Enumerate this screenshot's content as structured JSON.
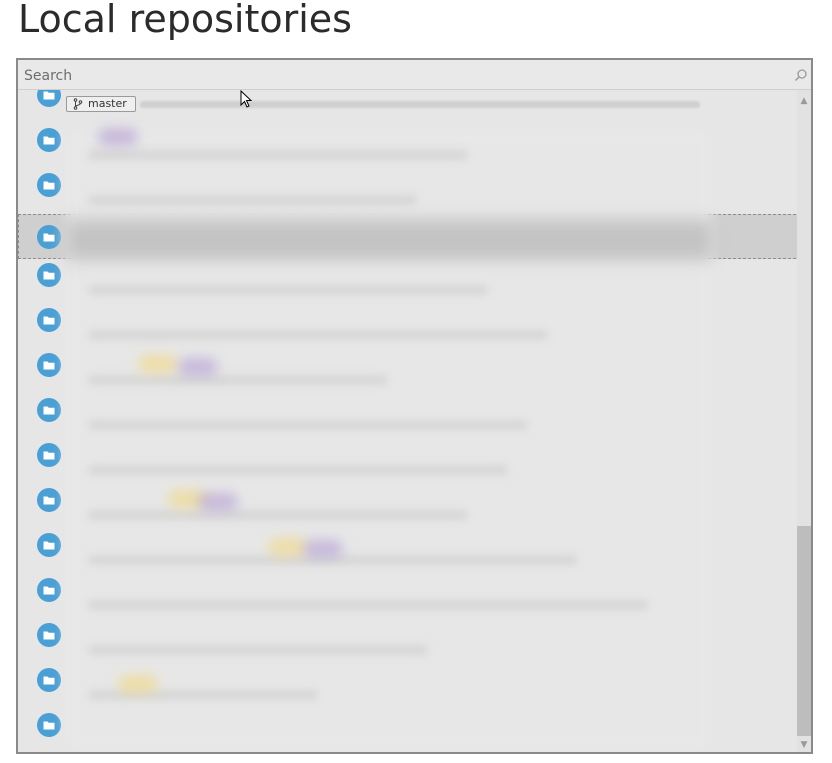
{
  "page": {
    "title": "Local repositories"
  },
  "search": {
    "placeholder": "Search"
  },
  "repositories": {
    "first_row_branch": "master"
  },
  "scroll": {
    "position_fraction": 0.78
  },
  "colors": {
    "folder_icon": "#4a9fd5",
    "selection": "#cfcfcf",
    "panel_bg": "#e6e6e6"
  }
}
